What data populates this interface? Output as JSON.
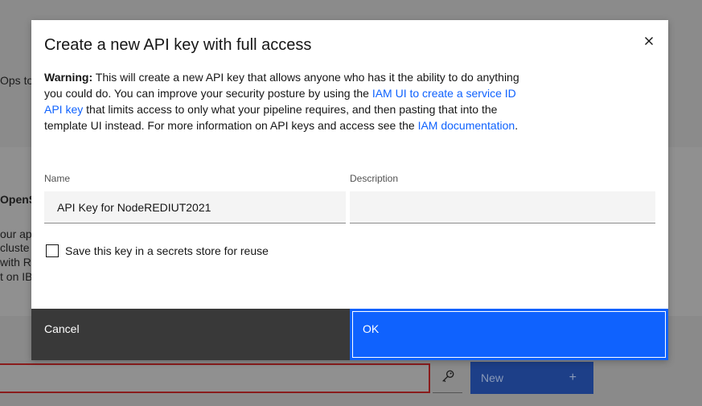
{
  "background": {
    "fragments": [
      "Ops too",
      "OpenS",
      "our app",
      "cluste",
      "with Re",
      "t on IB"
    ],
    "new_button_label": "New",
    "new_button_plus": "+"
  },
  "dialog": {
    "title": "Create a new API key with full access",
    "close_icon": "close-icon",
    "warning": {
      "label": "Warning:",
      "text_1": " This will create a new API key that allows anyone who has it the ability to do anything you could do. You can improve your security posture by using the ",
      "link_1": "IAM UI to create a service ID API key",
      "text_2": " that limits access to only what your pipeline requires, and then pasting that into the template UI instead. For more information on API keys and access see the ",
      "link_2": "IAM documentation",
      "text_3": "."
    },
    "name_label": "Name",
    "name_value": "API Key for NodeREDIUT2021",
    "description_label": "Description",
    "description_value": "",
    "checkbox_label": "Save this key in a secrets store for reuse",
    "checkbox_checked": false,
    "cancel_label": "Cancel",
    "ok_label": "OK"
  },
  "colors": {
    "primary": "#0f62fe",
    "secondary": "#393939",
    "overlay": "#8d8d8d"
  }
}
